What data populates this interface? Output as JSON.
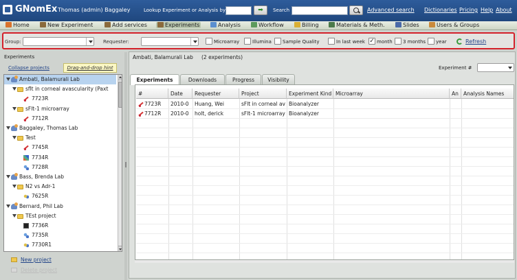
{
  "header": {
    "app_title": "GNomEx",
    "user": "Thomas (admin) Baggaley",
    "lookup_label": "Lookup Experiment or Analysis by #",
    "lookup_value": "",
    "search_label": "Search",
    "search_value": "",
    "links": {
      "advanced_search": "Advanced search",
      "dictionaries": "Dictionaries",
      "pricing": "Pricing",
      "help": "Help",
      "about": "About"
    }
  },
  "nav": [
    {
      "label": "Home",
      "icon": "home-icon",
      "color": "#d9732c"
    },
    {
      "label": "New Experiment",
      "icon": "flask-icon",
      "color": "#8a6a3c"
    },
    {
      "label": "Add services",
      "icon": "flask-icon",
      "color": "#8a6a3c"
    },
    {
      "label": "Experiments",
      "icon": "flask-icon",
      "color": "#8a6a3c"
    },
    {
      "label": "Analysis",
      "icon": "chart-icon",
      "color": "#5a8fcf"
    },
    {
      "label": "Workflow",
      "icon": "workflow-icon",
      "color": "#5c9a5c"
    },
    {
      "label": "Billing",
      "icon": "billing-icon",
      "color": "#d9b035"
    },
    {
      "label": "Materials & Meth.",
      "icon": "book-icon",
      "color": "#4a7a4a"
    },
    {
      "label": "Slides",
      "icon": "slides-icon",
      "color": "#4a6aa8"
    },
    {
      "label": "Users & Groups",
      "icon": "users-icon",
      "color": "#c98a3c"
    }
  ],
  "filters": {
    "group_label": "Group:",
    "group_value": "",
    "requester_label": "Requester:",
    "requester_value": "",
    "checkboxes": [
      {
        "label": "Microarray",
        "checked": false
      },
      {
        "label": "Illumina",
        "checked": false
      },
      {
        "label": "Sample Quality",
        "checked": false
      },
      {
        "label": "In last week",
        "checked": false
      },
      {
        "label": "month",
        "checked": true
      },
      {
        "label": "3 months",
        "checked": false
      },
      {
        "label": "year",
        "checked": false
      }
    ],
    "refresh_label": "Refresh"
  },
  "left_panel": {
    "title": "Experiments",
    "collapse_label": "Collapse projects",
    "hint_label": "Drag-and-drop hint",
    "tree": [
      {
        "level": 0,
        "type": "lab",
        "label": "Ambati, Balamurali Lab",
        "selected": true
      },
      {
        "level": 1,
        "type": "folder",
        "label": "sflt in corneal avascularity (Paxt"
      },
      {
        "level": 2,
        "type": "exp-red",
        "label": "7723R"
      },
      {
        "level": 1,
        "type": "folder",
        "label": "sFlt-1 microarray"
      },
      {
        "level": 2,
        "type": "exp-red",
        "label": "7712R"
      },
      {
        "level": 0,
        "type": "lab",
        "label": "Baggaley, Thomas Lab"
      },
      {
        "level": 1,
        "type": "folder",
        "label": "Test"
      },
      {
        "level": 2,
        "type": "exp-red",
        "label": "7745R"
      },
      {
        "level": 2,
        "type": "exp-mix",
        "label": "7734R"
      },
      {
        "level": 2,
        "type": "exp-blu",
        "label": "7728R"
      },
      {
        "level": 0,
        "type": "lab",
        "label": "Bass, Brenda Lab"
      },
      {
        "level": 1,
        "type": "folder",
        "label": "N2 vs  Adr-1"
      },
      {
        "level": 2,
        "type": "exp-blu2",
        "label": "7625R"
      },
      {
        "level": 0,
        "type": "lab",
        "label": "Bernard, Phil Lab"
      },
      {
        "level": 1,
        "type": "folder",
        "label": "TEst project"
      },
      {
        "level": 2,
        "type": "exp-blk",
        "label": "7736R"
      },
      {
        "level": 2,
        "type": "exp-blu",
        "label": "7735R"
      },
      {
        "level": 2,
        "type": "exp-blu2",
        "label": "7730R1"
      },
      {
        "level": 2,
        "type": "exp-blu",
        "label": "7730R"
      }
    ],
    "new_project_label": "New project",
    "faded_link_label": "Delete project"
  },
  "main": {
    "title": "Ambati, Balamurali Lab",
    "count": "(2 experiments)",
    "exp_number_label": "Experiment #",
    "exp_number_value": "",
    "tabs": [
      {
        "label": "Experiments",
        "active": true
      },
      {
        "label": "Downloads",
        "active": false
      },
      {
        "label": "Progress",
        "active": false
      },
      {
        "label": "Visibility",
        "active": false
      }
    ],
    "columns": [
      "#",
      "Date",
      "Requester",
      "Project",
      "Experiment Kind",
      "Microarray",
      "An",
      "Analysis Names"
    ],
    "rows": [
      {
        "number": "7723R",
        "date": "2010-0",
        "requester": "Huang, Wei",
        "project": "sFlt in corneal av",
        "kind": "Bioanalyzer",
        "microarray": "",
        "an": "",
        "analysis": ""
      },
      {
        "number": "7712R",
        "date": "2010-0",
        "requester": "holt, derick",
        "project": "sFlt-1 microarray",
        "kind": "Bioanalyzer",
        "microarray": "",
        "an": "",
        "analysis": ""
      }
    ]
  }
}
